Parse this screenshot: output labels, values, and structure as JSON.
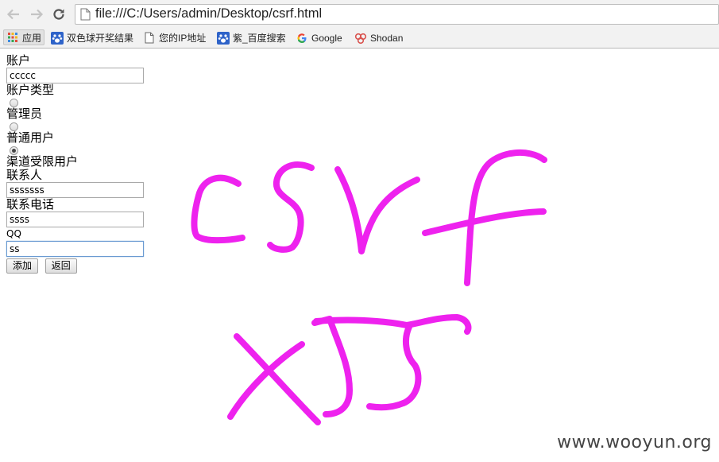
{
  "browser": {
    "url": "file:///C:/Users/admin/Desktop/csrf.html",
    "bookmarks": [
      {
        "label": "应用",
        "icon": "apps-grid-icon"
      },
      {
        "label": "双色球开奖结果",
        "icon": "baidu-paw-icon"
      },
      {
        "label": "您的IP地址",
        "icon": "page-icon"
      },
      {
        "label": "紫_百度搜索",
        "icon": "baidu-paw-icon"
      },
      {
        "label": "Google",
        "icon": "google-icon"
      },
      {
        "label": "Shodan",
        "icon": "shodan-icon"
      }
    ]
  },
  "form": {
    "account_label": "账户",
    "account_value": "ccccc",
    "account_type_label": "账户类型",
    "options": [
      {
        "label": "管理员",
        "checked": false
      },
      {
        "label": "普通用户",
        "checked": false
      },
      {
        "label": "渠道受限用户",
        "checked": true
      }
    ],
    "contact_label": "联系人",
    "contact_value": "sssssss",
    "phone_label": "联系电话",
    "phone_value": "ssss",
    "qq_label": "QQ",
    "qq_value": "ss",
    "add_button": "添加",
    "back_button": "返回"
  },
  "annotation": {
    "handwriting": [
      "csrf",
      "xss"
    ],
    "color": "#ee22ee"
  },
  "watermark": "www.wooyun.org"
}
